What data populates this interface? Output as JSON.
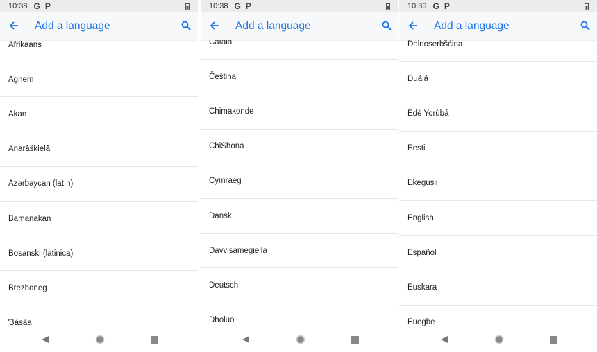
{
  "accent_color": "#1a73e8",
  "icons": {
    "back": "arrow-left-icon",
    "search": "search-icon",
    "battery": "battery-icon",
    "nav_back": "triangle-back-icon",
    "nav_home": "circle-home-icon",
    "nav_recents": "square-recents-icon"
  },
  "panels": [
    {
      "status": {
        "time": "10:38",
        "notif1": "G",
        "notif2": "P"
      },
      "title": "Add a language",
      "items": [
        "Afrikaans",
        "Aghem",
        "Akan",
        "Anarâškielâ",
        "Azərbaycan (latın)",
        "Bamanakan",
        "Bosanski (latinica)",
        "Brezhoneg",
        "Ɓàsàa"
      ]
    },
    {
      "status": {
        "time": "10:38",
        "notif1": "G",
        "notif2": "P"
      },
      "title": "Add a language",
      "items": [
        "Català",
        "Čeština",
        "Chimakonde",
        "ChiShona",
        "Cymraeg",
        "Dansk",
        "Davvisámegiella",
        "Deutsch",
        "Dholuo"
      ]
    },
    {
      "status": {
        "time": "10:39",
        "notif1": "G",
        "notif2": "P"
      },
      "title": "Add a language",
      "items": [
        "Dolnoserbšćina",
        "Duálá",
        "Èdè Yorùbá",
        "Eesti",
        "Ekegusii",
        "English",
        "Español",
        "Euskara",
        "Eʋegbe"
      ]
    }
  ]
}
